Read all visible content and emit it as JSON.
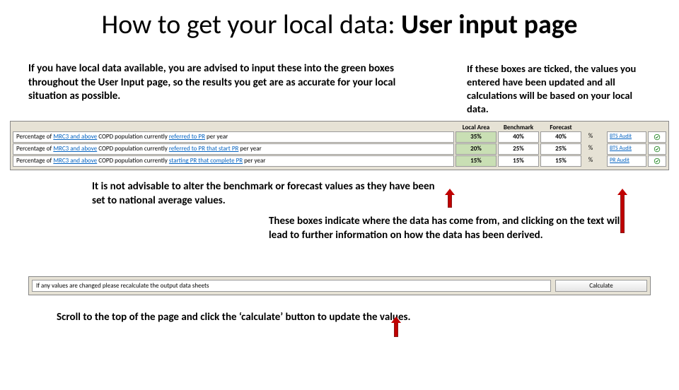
{
  "title_plain": "How to get your local data: ",
  "title_bold": "User input page",
  "intro_left": "If you have local data available, you are advised to input these into the green boxes throughout the User Input page, so the results you get are as accurate for your local situation as possible.",
  "intro_right": "If these boxes are ticked, the values you entered have been updated and all calculations will be based on your local data.",
  "headers": {
    "local": "Local Area",
    "bench": "Benchmark",
    "forecast": "Forecast"
  },
  "rows": [
    {
      "label_pre": "Percentage of ",
      "label_link": "MRC3 and above",
      "label_mid": " COPD population currently ",
      "label_link2": "referred to PR",
      "label_post": " per year",
      "local": "35%",
      "bench": "40%",
      "forecast": "40%",
      "unit": "%",
      "audit": "BTS Audit"
    },
    {
      "label_pre": "Percentage of ",
      "label_link": "MRC3 and above",
      "label_mid": " COPD population currently ",
      "label_link2": "referred to PR that start PR",
      "label_post": " per year",
      "local": "20%",
      "bench": "25%",
      "forecast": "25%",
      "unit": "%",
      "audit": "BTS Audit"
    },
    {
      "label_pre": "Percentage of ",
      "label_link": "MRC3 and above",
      "label_mid": " COPD population currently ",
      "label_link2": "starting PR that complete PR",
      "label_post": " per year",
      "local": "15%",
      "bench": "15%",
      "forecast": "15%",
      "unit": "%",
      "audit": "PR Audit"
    }
  ],
  "note1": "It is not advisable to alter the benchmark or forecast values as they have been set to national average values.",
  "note2": "These boxes indicate where the data has come from, and clicking on the text will lead to further information on how the data has been derived.",
  "calc_text": "If any values are changed please recalculate the output data sheets",
  "calc_btn": "Calculate",
  "note3": "Scroll to the top of the page and click the ‘calculate’ button to update the values."
}
